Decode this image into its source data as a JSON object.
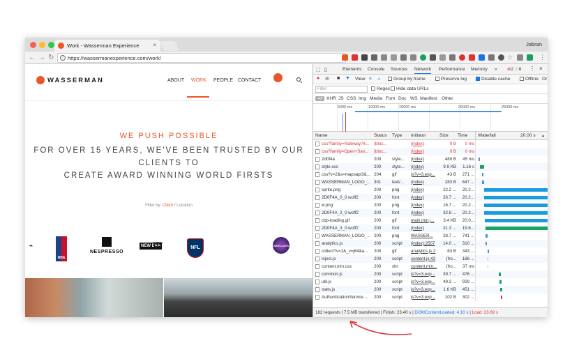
{
  "browser": {
    "tab_title": "Work - Wasserman Experience",
    "profile": "Jabran",
    "url": "https://wassermanexperience.com/work/"
  },
  "site": {
    "brand": "WASSERMAN",
    "nav": [
      "ABOUT",
      "WORK",
      "PEOPLE",
      "CONTACT"
    ],
    "tagline": "WE PUSH POSSIBLE",
    "headline": [
      "FOR OVER 15 YEARS, WE'VE BEEN TRUSTED BY OUR",
      "CLIENTS TO",
      "CREATE AWARD WINNING WORLD FIRSTS"
    ],
    "filter_label": "Filter by:",
    "filter_client": "Client",
    "filter_sep": "/",
    "filter_location": "Location",
    "clients": [
      "NBA",
      "NESPRESSO",
      "NEW ERA",
      "NEW CITY",
      "NFL",
      "BARCLAYS"
    ]
  },
  "devtools": {
    "tabs": [
      "Elements",
      "Console",
      "Sources",
      "Network",
      "Performance",
      "Memory",
      "»"
    ],
    "selected_tab": "Network",
    "errors": "2",
    "warnings": "6",
    "toolbar": {
      "view": "View:",
      "group_by_frame": "Group by frame",
      "preserve_log": "Preserve log",
      "disable_cache": "Disable cache",
      "offline": "Offline",
      "online": "Or"
    },
    "filter_placeholder": "Filter",
    "regex": "Regex",
    "hide_data_urls": "Hide data URLs",
    "types": [
      "All",
      "XHR",
      "JS",
      "CSS",
      "Img",
      "Media",
      "Font",
      "Doc",
      "WS",
      "Manifest",
      "Other"
    ],
    "timeline_ticks": [
      "5000 ms",
      "10000 ms",
      "15000 ms",
      "20000 ms",
      "25000 ms"
    ],
    "columns": {
      "name": "Name",
      "status": "Status",
      "type": "Type",
      "initiator": "Initiator",
      "size": "Size",
      "time": "Time",
      "waterfall": "Waterfall",
      "waterfall_time": "20.00 s"
    },
    "rows": [
      {
        "name": "css?family=Raleway:%...",
        "status": "(bloc...",
        "type": "",
        "initiator": "(index)",
        "size": "0 B",
        "time": "0 ms",
        "err": true
      },
      {
        "name": "css?family=Open+San...",
        "status": "(bloc...",
        "type": "",
        "initiator": "(index)",
        "size": "0 B",
        "time": "0 ms",
        "err": true
      },
      {
        "name": "2d0f4a",
        "status": "200",
        "type": "style...",
        "initiator": "(index)",
        "size": "480 B",
        "time": "45 ms",
        "err": false
      },
      {
        "name": "style.css",
        "status": "200",
        "type": "style...",
        "initiator": "(index)",
        "size": "9.9 KB",
        "time": "1.16 s",
        "err": false
      },
      {
        "name": "css?v=2&s=mapsapi3&...",
        "status": "204",
        "type": "gif",
        "initiator": "js?v=3.exp...",
        "size": "43 B",
        "time": "271 ...",
        "err": false
      },
      {
        "name": "WASSERMAN_LOGO_...",
        "status": "301",
        "type": "text/...",
        "initiator": "(index)",
        "size": "283 B",
        "time": "647 ...",
        "err": false
      },
      {
        "name": "sprite.png",
        "status": "200",
        "type": "png",
        "initiator": "(index)",
        "size": "22.2 ...",
        "time": "20.2...",
        "err": false
      },
      {
        "name": "2D0F4A_0_0.woff2",
        "status": "200",
        "type": "font",
        "initiator": "(index)",
        "size": "33.7 ...",
        "time": "20.2...",
        "err": false
      },
      {
        "name": "w.png",
        "status": "200",
        "type": "png",
        "initiator": "(index)",
        "size": "16.7 ...",
        "time": "20.2...",
        "err": false
      },
      {
        "name": "2D0F4A_2_0.woff2",
        "status": "200",
        "type": "font",
        "initiator": "(index)",
        "size": "32.8 ...",
        "time": "20.2...",
        "err": false
      },
      {
        "name": "cbp-loading.gif",
        "status": "200",
        "type": "gif",
        "initiator": "main.min.j...",
        "size": "3.4 KB",
        "time": "20.0...",
        "err": false
      },
      {
        "name": "2D0F4A_3_0.woff2",
        "status": "200",
        "type": "font",
        "initiator": "(index)",
        "size": "31.3 ...",
        "time": "19.6...",
        "err": false
      },
      {
        "name": "WASSERMAN_LOGO_...",
        "status": "200",
        "type": "png",
        "initiator": "WASSER...",
        "size": "28.7 ...",
        "time": "741 ...",
        "err": false
      },
      {
        "name": "analytics.js",
        "status": "200",
        "type": "script",
        "initiator": "(index):2507",
        "size": "14.0 ...",
        "time": "310 ...",
        "err": false
      },
      {
        "name": "collect?v=1&_v=j64&a...",
        "status": "200",
        "type": "gif",
        "initiator": "analytics.js:2",
        "size": "63 B",
        "time": "343 ...",
        "err": false
      },
      {
        "name": "inject.js",
        "status": "200",
        "type": "script",
        "initiator": "content.js:43",
        "size": "(fro...",
        "time": "186 ...",
        "err": false
      },
      {
        "name": "content.min.css",
        "status": "200",
        "type": "xhr",
        "initiator": "content.min...",
        "size": "(fro...",
        "time": "37 ms",
        "err": false
      },
      {
        "name": "common.js",
        "status": "200",
        "type": "script",
        "initiator": "js?v=3.exp...",
        "size": "39.7 ...",
        "time": "476 ...",
        "err": false
      },
      {
        "name": "util.js",
        "status": "200",
        "type": "script",
        "initiator": "js?v=3.exp...",
        "size": "49.3 ...",
        "time": "929 ...",
        "err": false
      },
      {
        "name": "stats.js",
        "status": "200",
        "type": "script",
        "initiator": "js?v=3.exp...",
        "size": "1.6 KB",
        "time": "451 ...",
        "err": false
      },
      {
        "name": "AuthenticationService....",
        "status": "200",
        "type": "script",
        "initiator": "js?v=3.exp...",
        "size": "102 B",
        "time": "302 ...",
        "err": false
      }
    ],
    "status_bar": {
      "summary": "182 requests | 7.5 MB transferred | Finish: 23.40 s |",
      "dcl": "DOMContentLoaded: 4.10 s",
      "load": "Load: 23.69 s"
    }
  },
  "colors": {
    "brand": "#e8572a",
    "devtools_accent": "#1a73e8",
    "error": "#dd3333"
  }
}
